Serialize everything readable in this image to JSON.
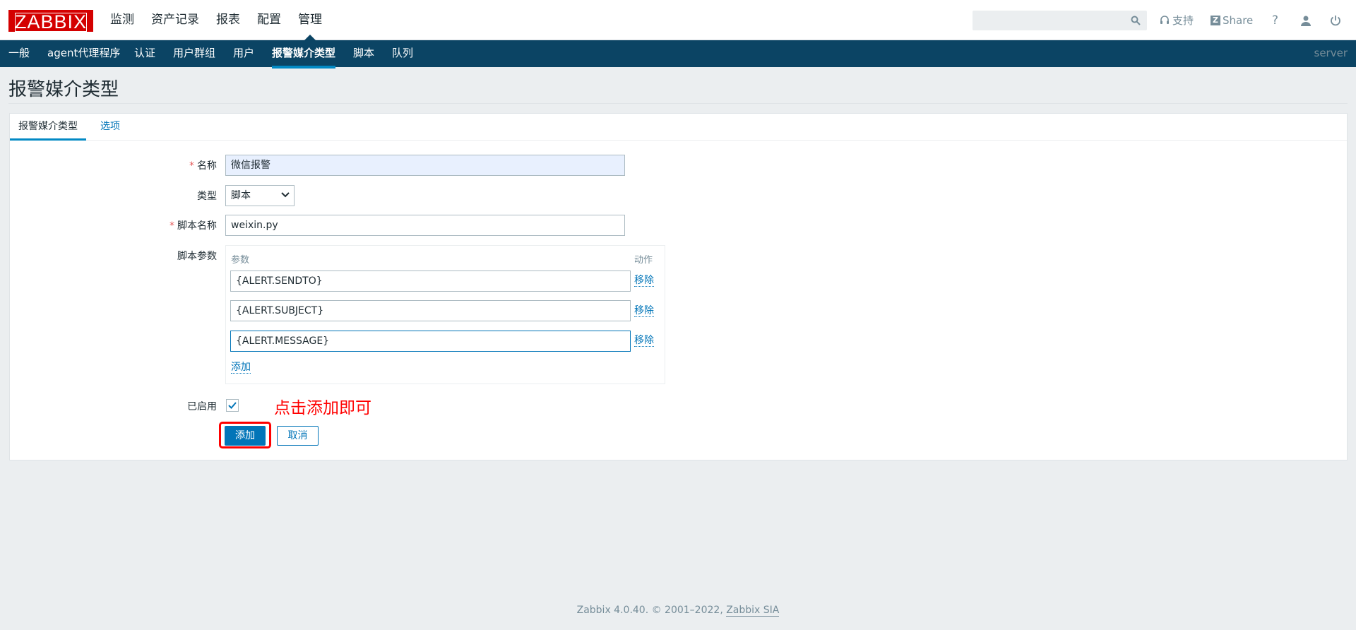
{
  "logo": {
    "text": "ZABBIX"
  },
  "main_menu": [
    "监测",
    "资产记录",
    "报表",
    "配置",
    "管理"
  ],
  "main_menu_active": "管理",
  "search": {
    "value": "",
    "icon": "search-icon"
  },
  "toolbar": {
    "support": "支持",
    "share": "Share",
    "help": "?"
  },
  "sub_nav": {
    "items": [
      "一般",
      "agent代理程序",
      "认证",
      "用户群组",
      "用户",
      "报警媒介类型",
      "脚本",
      "队列"
    ],
    "active": "报警媒介类型",
    "server": "server"
  },
  "page_title": "报警媒介类型",
  "tabs": [
    "报警媒介类型",
    "选项"
  ],
  "form": {
    "name_label": "名称",
    "name_value": "微信报警",
    "type_label": "类型",
    "type_value": "脚本",
    "script_name_label": "脚本名称",
    "script_name_value": "weixin.py",
    "script_params_label": "脚本参数",
    "params_header": "参数",
    "action_header": "动作",
    "params": [
      "{ALERT.SENDTO}",
      "{ALERT.SUBJECT}",
      "{ALERT.MESSAGE}"
    ],
    "remove_label": "移除",
    "add_param_label": "添加",
    "enabled_label": "已启用",
    "enabled": true,
    "add_button": "添加",
    "cancel_button": "取消"
  },
  "annotation": "点击添加即可",
  "footer": {
    "text": "Zabbix 4.0.40. © 2001–2022, ",
    "link": "Zabbix SIA"
  },
  "colors": {
    "brand": "#d40000",
    "subnav": "#0b4464",
    "accent": "#0275b8",
    "annotation": "#ff0000"
  }
}
